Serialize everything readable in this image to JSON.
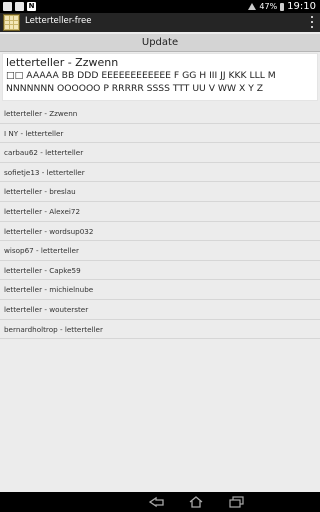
{
  "status_bar": {
    "battery_percent": "47%",
    "time": "19:10",
    "notification_icon": "N"
  },
  "action_bar": {
    "app_title": "Letterteller-free"
  },
  "update_button": {
    "label": "Update"
  },
  "header_card": {
    "title": "letterteller - Zzwenn",
    "letters": "□□ AAAAA BB DDD EEEEEEEEEEEE F GG H III JJ KKK LLL M NNNNNNN OOOOOO P RRRRR SSSS TTT UU V WW X Y Z"
  },
  "games": [
    "letterteller - Zzwenn",
    "I NY - letterteller",
    "carbau62 - letterteller",
    "sofietje13 - letterteller",
    "letterteller - breslau",
    "letterteller - Alexei72",
    "letterteller - wordsup032",
    "wisop67 - letterteller",
    "letterteller - Capke59",
    "letterteller - michielnube",
    "letterteller - wouterster",
    "bernardholtrop - letterteller"
  ]
}
